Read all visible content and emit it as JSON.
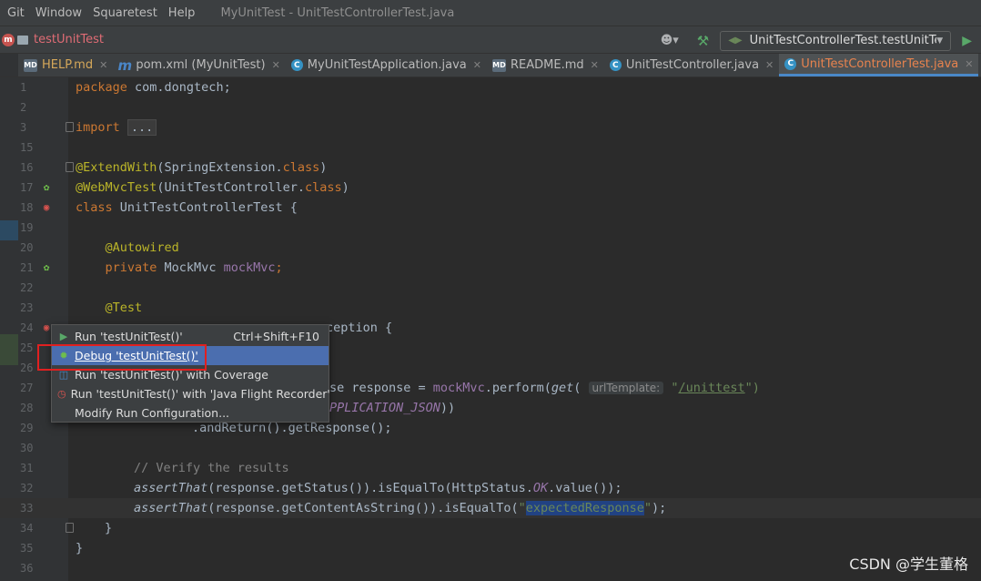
{
  "menu": {
    "items": [
      "Git",
      "Window",
      "Squaretest",
      "Help"
    ],
    "window_title": "MyUnitTest - UnitTestControllerTest.java"
  },
  "navbar": {
    "project": "testUnitTest",
    "run_config": "UnitTestControllerTest.testUnitTest"
  },
  "tabs": [
    {
      "label": "HELP.md",
      "icon": "markdown-icon"
    },
    {
      "label": "pom.xml (MyUnitTest)",
      "icon": "maven-icon"
    },
    {
      "label": "MyUnitTestApplication.java",
      "icon": "spring-app-icon"
    },
    {
      "label": "README.md",
      "icon": "markdown-icon"
    },
    {
      "label": "UnitTestController.java",
      "icon": "class-icon"
    },
    {
      "label": "UnitTestControllerTest.java",
      "icon": "class-icon"
    }
  ],
  "editor": {
    "lines": {
      "l1": "1",
      "l2": "2",
      "l3": "3",
      "l15": "15",
      "l16": "16",
      "l17": "17",
      "l18": "18",
      "l19": "19",
      "l20": "20",
      "l21": "21",
      "l22": "22",
      "l23": "23",
      "l24": "24",
      "l25": "25",
      "l26": "26",
      "l27": "27",
      "l28": "28",
      "l29": "29",
      "l30": "30",
      "l31": "31",
      "l32": "32",
      "l33": "33",
      "l34": "34",
      "l35": "35",
      "l36": "36"
    },
    "tokens": {
      "package_kw": "package",
      "package_name": " com.dongtech;",
      "import_kw": "import",
      "import_fold": "...",
      "extend_ann": "@ExtendWith",
      "extend_arg_open": "(SpringExtension.",
      "class_kw1": "class",
      "close_paren": ")",
      "webmvc_ann": "@WebMvcTest",
      "webmvc_arg_open": "(UnitTestController.",
      "class_kw2": "class",
      "close_paren2": ")",
      "class_kw3": "class",
      "class_name": " UnitTestControllerTest {",
      "autowired_ann": "@Autowired",
      "private_kw": "private",
      "mockmvc_type": " MockMvc ",
      "mockmvc_field": "mockMvc",
      "semicolon": ";",
      "test_ann": "@Test",
      "line24_tail": "ception {",
      "line27_mid": "se response = ",
      "line27_field": "mockMvc",
      "line27_perform": ".perform(",
      "line27_get": "get",
      "line27_paren": "( ",
      "line27_hint": "urlTemplate:",
      "line27_quote_open": " \"",
      "line27_url": "/unittest",
      "line27_quote_close": "\")",
      "line28_const": "PPLICATION_JSON",
      "line28_close": "))",
      "line29_code": ".andReturn().getResponse();",
      "line31_comment": "// Verify the results",
      "assert_that": "assertThat",
      "line32_mid": "(response.getStatus()).isEqualTo(HttpStatus.",
      "line32_ok": "OK",
      "line32_end": ".value());",
      "line33_mid": "(response.getContentAsString()).isEqualTo(",
      "line33_q1": "\"",
      "line33_str": "expectedResponse",
      "line33_q2": "\"",
      "line33_end": ");",
      "brace_close1": "}",
      "brace_close2": "}"
    }
  },
  "popup": {
    "items": [
      {
        "label": "Run 'testUnitTest()'",
        "shortcut": "Ctrl+Shift+F10"
      },
      {
        "label": "Debug 'testUnitTest()'",
        "shortcut": ""
      },
      {
        "label": "Run 'testUnitTest()' with Coverage",
        "shortcut": ""
      },
      {
        "label": "Run 'testUnitTest()' with 'Java Flight Recorder'",
        "shortcut": ""
      },
      {
        "label": "Modify Run Configuration...",
        "shortcut": ""
      }
    ]
  },
  "watermark": "CSDN @学生董格",
  "colors": {
    "background": "#2b2b2b",
    "keyword": "#cc7832",
    "annotation": "#bbb529",
    "field": "#9876aa",
    "string": "#6a8759",
    "popup_selection": "#4b6eaf",
    "highlight_box": "#e02020"
  }
}
